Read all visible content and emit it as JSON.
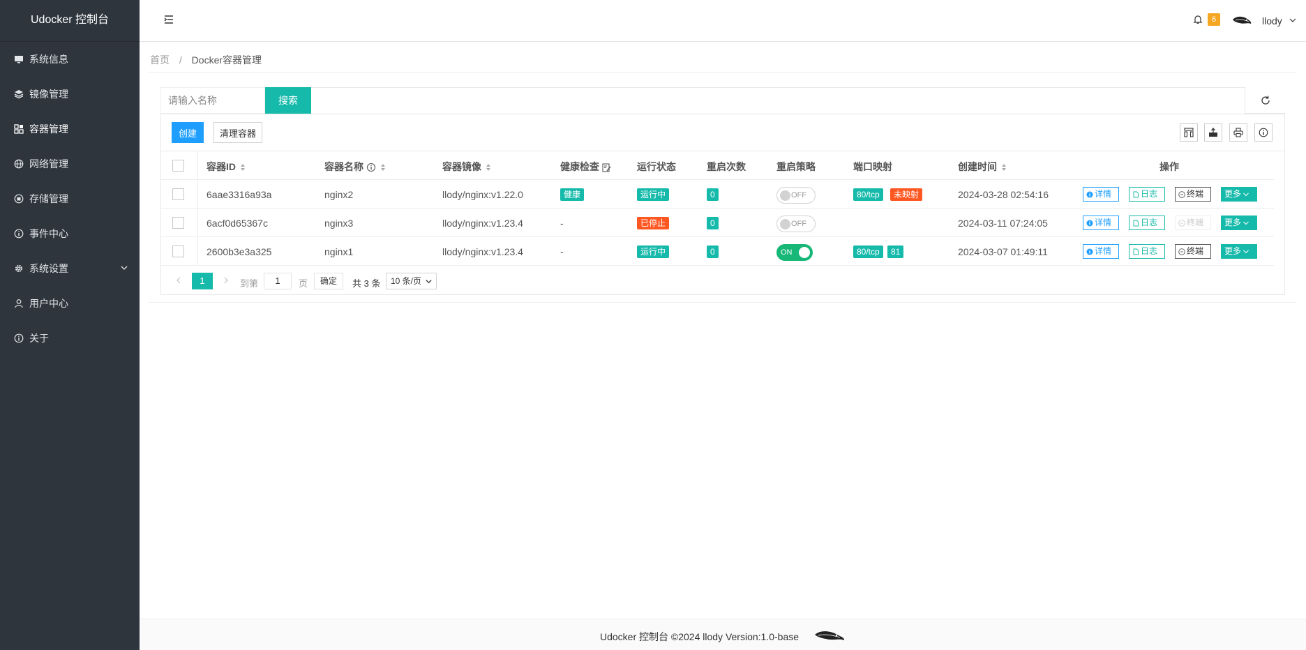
{
  "app": {
    "title": "Udocker 控制台"
  },
  "sidebar": {
    "items": [
      {
        "label": "系统信息",
        "icon": "monitor-icon"
      },
      {
        "label": "镜像管理",
        "icon": "layers-icon"
      },
      {
        "label": "容器管理",
        "icon": "grid-icon",
        "active": true
      },
      {
        "label": "网络管理",
        "icon": "globe-icon"
      },
      {
        "label": "存储管理",
        "icon": "storage-icon"
      },
      {
        "label": "事件中心",
        "icon": "info-circle-icon"
      },
      {
        "label": "系统设置",
        "icon": "gear-icon",
        "expandable": true
      },
      {
        "label": "用户中心",
        "icon": "user-icon"
      },
      {
        "label": "关于",
        "icon": "info-circle-icon"
      }
    ]
  },
  "header": {
    "notification_count": "6",
    "username": "llody"
  },
  "breadcrumb": {
    "home": "首页",
    "separator": "/",
    "current": "Docker容器管理"
  },
  "search": {
    "placeholder": "请输入名称",
    "button": "搜索"
  },
  "toolbar": {
    "create": "创建",
    "clean": "清理容器"
  },
  "table": {
    "headers": {
      "id": "容器ID",
      "name": "容器名称",
      "image": "容器镜像",
      "health": "健康检查",
      "status": "运行状态",
      "restarts": "重启次数",
      "policy": "重启策略",
      "ports": "端口映射",
      "created": "创建时间",
      "actions": "操作"
    },
    "rows": [
      {
        "id": "6aae3316a93a",
        "name": "nginx2",
        "image": "llody/nginx:v1.22.0",
        "health": "健康",
        "status": "运行中",
        "restarts": "0",
        "policy": "OFF",
        "port1": "80/tcp",
        "port2": "未映射",
        "created": "2024-03-28 02:54:16"
      },
      {
        "id": "6acf0d65367c",
        "name": "nginx3",
        "image": "llody/nginx:v1.23.4",
        "health": "-",
        "status": "已停止",
        "restarts": "0",
        "policy": "OFF",
        "created": "2024-03-11 07:24:05"
      },
      {
        "id": "2600b3e3a325",
        "name": "nginx1",
        "image": "llody/nginx:v1.23.4",
        "health": "-",
        "status": "运行中",
        "restarts": "0",
        "policy": "ON",
        "port1": "80/tcp",
        "port2": "81",
        "created": "2024-03-07 01:49:11"
      }
    ],
    "actions": {
      "detail": "详情",
      "log": "日志",
      "terminal": "终端",
      "more": "更多"
    }
  },
  "pagination": {
    "current": "1",
    "goto_label": "到第",
    "page_value": "1",
    "page_unit": "页",
    "confirm": "确定",
    "total": "共 3 条",
    "page_size": "10 条/页"
  },
  "footer": {
    "text": "Udocker 控制台 ©2024 llody Version:1.0-base"
  },
  "colors": {
    "sidebar": "#2f353d",
    "primary": "#16baaa",
    "blue": "#1e9fff",
    "danger": "#ff5722",
    "switch_on": "#16b777"
  }
}
